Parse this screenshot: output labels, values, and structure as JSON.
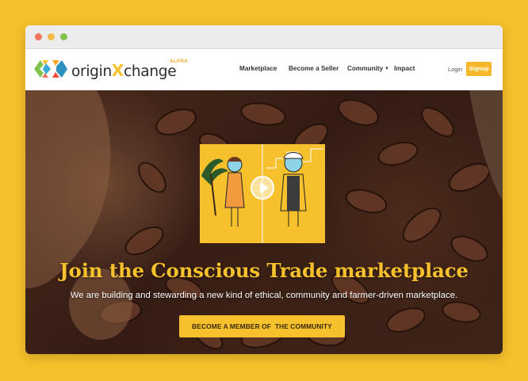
{
  "colors": {
    "background": "#f6c12c",
    "accent": "#f6b82a",
    "headline": "#f6c12c",
    "logo_x": "#f6c12c"
  },
  "browser": {
    "controls": [
      "close-dot",
      "minimize-dot",
      "maximize-dot"
    ]
  },
  "header": {
    "brand_prefix": "origin",
    "brand_x": "X",
    "brand_suffix": "change",
    "brand_badge": "ALPHA",
    "logo_icon": "originxchange-logo-icon",
    "nav": {
      "marketplace": "Marketplace",
      "seller": "Become a Seller",
      "community": "Community",
      "impact": "Impact"
    },
    "dropdown_icon": "caret-down-icon",
    "login": "Login",
    "signup": "Signup"
  },
  "hero": {
    "video_icon": "play-icon",
    "headline": "Join the Conscious Trade marketplace",
    "subheadline": "We are building and stewarding a new kind of ethical, community and farmer-driven marketplace.",
    "cta": "BECOME A MEMBER OF  THE COMMUNITY"
  }
}
